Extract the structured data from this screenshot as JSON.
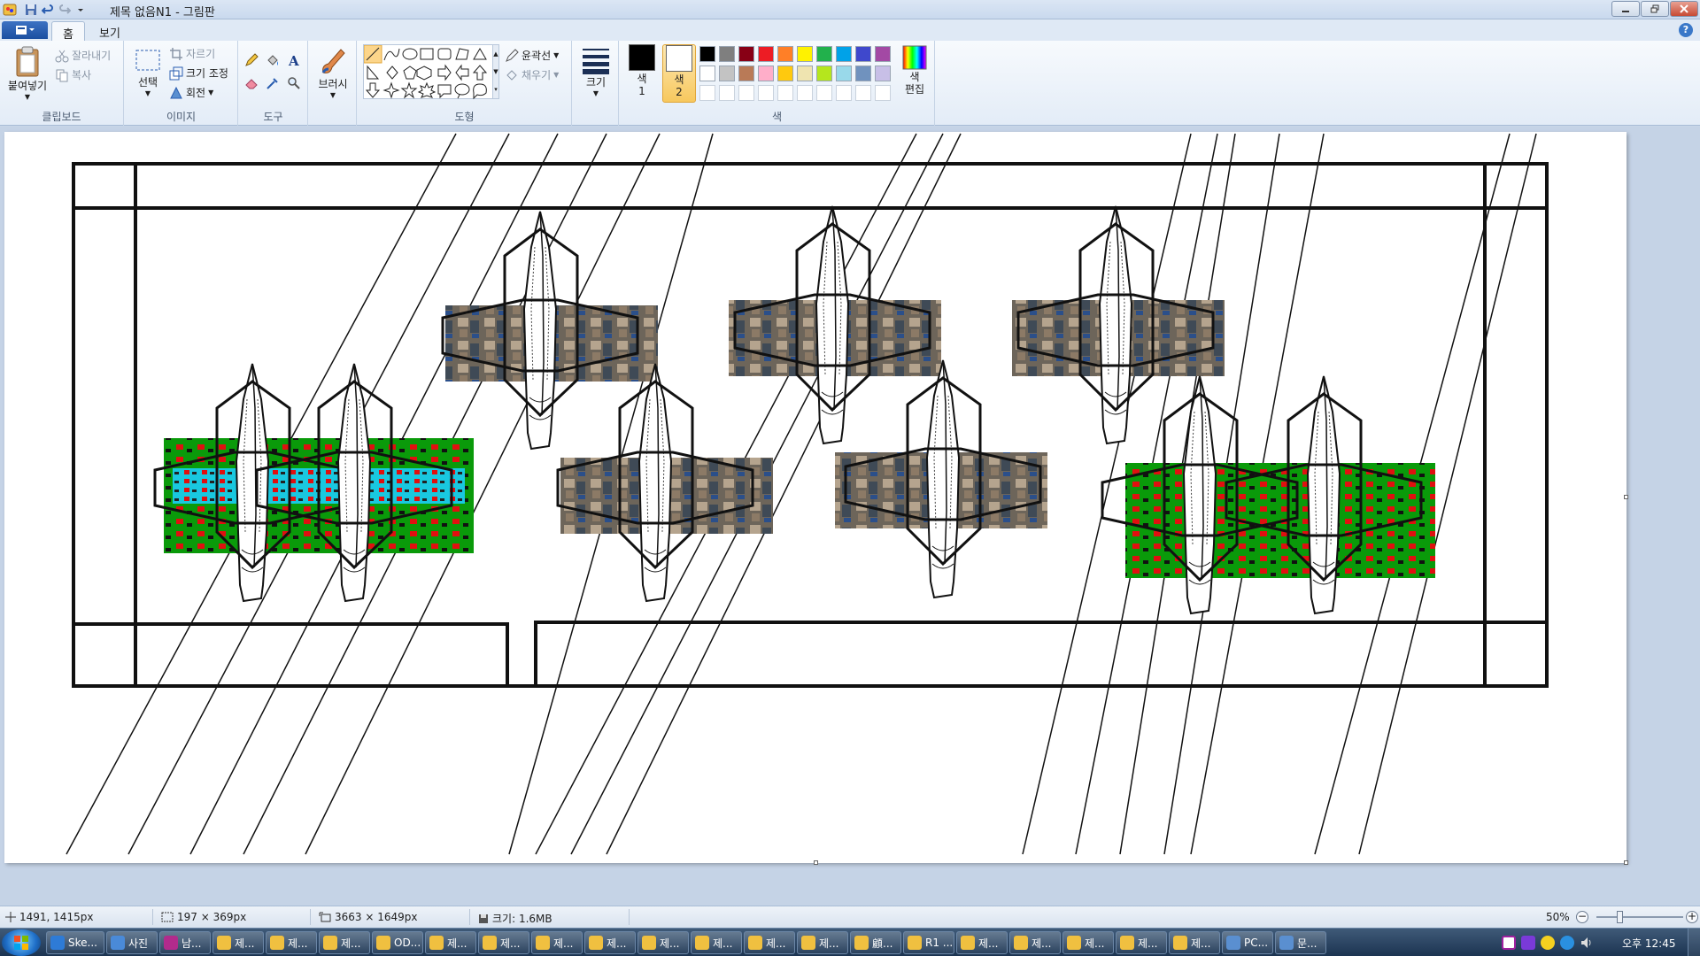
{
  "window": {
    "title": "제목 없음N1 - 그림판"
  },
  "tabs": {
    "home": "홈",
    "view": "보기"
  },
  "ribbon": {
    "clipboard": {
      "group_label": "클립보드",
      "paste": "붙여넣기",
      "cut": "잘라내기",
      "copy": "복사"
    },
    "image": {
      "group_label": "이미지",
      "select": "선택",
      "crop": "자르기",
      "resize": "크기 조정",
      "rotate": "회전"
    },
    "tools": {
      "group_label": "도구"
    },
    "brushes": {
      "label": "브러시"
    },
    "shapes": {
      "group_label": "도형",
      "outline": "윤곽선",
      "fill": "채우기"
    },
    "size": {
      "label": "크기"
    },
    "colors": {
      "group_label": "색",
      "color1_line1": "색",
      "color1_line2": "1",
      "color2_line1": "색",
      "color2_line2": "2",
      "edit_line1": "색",
      "edit_line2": "편집",
      "color1": "#000000",
      "color2": "#ffffff",
      "palette_row1": [
        "#000000",
        "#7f7f7f",
        "#880015",
        "#ed1c24",
        "#ff7f27",
        "#fff200",
        "#22b14c",
        "#00a2e8",
        "#3f48cc",
        "#a349a4"
      ],
      "palette_row2": [
        "#ffffff",
        "#c3c3c3",
        "#b97a57",
        "#ffaec9",
        "#ffc90e",
        "#efe4b0",
        "#b5e61d",
        "#99d9ea",
        "#7092be",
        "#c8bfe7"
      ],
      "palette_row3": [
        "#ffffff",
        "#ffffff",
        "#ffffff",
        "#ffffff",
        "#ffffff",
        "#ffffff",
        "#ffffff",
        "#ffffff",
        "#ffffff",
        "#ffffff"
      ]
    }
  },
  "status": {
    "cursor_pos": "1491, 1415px",
    "selection_size": "197 × 369px",
    "image_size": "3663 × 1649px",
    "file_size": "크기: 1.6MB",
    "zoom": "50%",
    "zoom_fraction": 0.5
  },
  "taskbar": {
    "items": [
      {
        "label": "Ske...",
        "color": "#2e7bd6"
      },
      {
        "label": "사진",
        "color": "#4a8ad8"
      },
      {
        "label": "남...",
        "color": "#b22b8c"
      },
      {
        "label": "제...",
        "color": "#f0c040"
      },
      {
        "label": "제...",
        "color": "#f0c040"
      },
      {
        "label": "제...",
        "color": "#f0c040"
      },
      {
        "label": "OD...",
        "color": "#f0c040"
      },
      {
        "label": "제...",
        "color": "#f0c040"
      },
      {
        "label": "제...",
        "color": "#f0c040"
      },
      {
        "label": "제...",
        "color": "#f0c040"
      },
      {
        "label": "제...",
        "color": "#f0c040"
      },
      {
        "label": "제...",
        "color": "#f0c040"
      },
      {
        "label": "제...",
        "color": "#f0c040"
      },
      {
        "label": "제...",
        "color": "#f0c040"
      },
      {
        "label": "제...",
        "color": "#f0c040"
      },
      {
        "label": "顧...",
        "color": "#f0c040"
      },
      {
        "label": "R1 ...",
        "color": "#f0c040"
      },
      {
        "label": "제...",
        "color": "#f0c040"
      },
      {
        "label": "제...",
        "color": "#f0c040"
      },
      {
        "label": "제...",
        "color": "#f0c040"
      },
      {
        "label": "제...",
        "color": "#f0c040"
      },
      {
        "label": "제...",
        "color": "#f0c040"
      },
      {
        "label": "PC...",
        "color": "#5a8fd0"
      },
      {
        "label": "문...",
        "color": "#5a8fd0"
      }
    ],
    "clock": "오후 12:45"
  }
}
